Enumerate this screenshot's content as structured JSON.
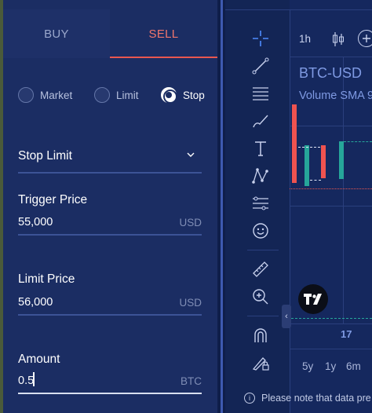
{
  "order_form": {
    "tabs": {
      "buy": "BUY",
      "sell": "SELL",
      "active": "sell"
    },
    "order_types": [
      {
        "label": "Market",
        "selected": false
      },
      {
        "label": "Limit",
        "selected": false
      },
      {
        "label": "Stop",
        "selected": true
      }
    ],
    "stop_type": {
      "value": "Stop Limit"
    },
    "trigger_price": {
      "label": "Trigger Price",
      "value": "55,000",
      "unit": "USD"
    },
    "limit_price": {
      "label": "Limit Price",
      "value": "56,000",
      "unit": "USD"
    },
    "amount": {
      "label": "Amount",
      "value": "0.5",
      "unit": "BTC"
    }
  },
  "chart": {
    "symbol": "BTC-USD",
    "indicator": "Volume SMA 9",
    "interval": "1h",
    "x_label": "17",
    "ranges": [
      "5y",
      "1y",
      "6m"
    ],
    "notice": "Please note that data pre",
    "colors": {
      "up": "#26a69a",
      "down": "#ef5350",
      "accent": "#e8574f"
    },
    "tools": [
      "crosshair-icon",
      "trend-line-icon",
      "horizontal-lines-icon",
      "brush-icon",
      "text-icon",
      "pattern-icon",
      "forecast-icon",
      "emoji-icon",
      "ruler-icon",
      "zoom-in-icon",
      "magnet-icon",
      "lock-drawing-icon"
    ]
  }
}
